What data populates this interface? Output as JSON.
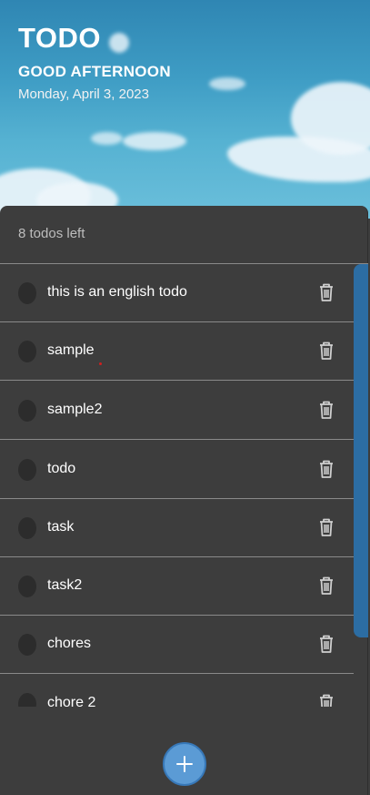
{
  "header": {
    "title": "TODO",
    "greeting": "GOOD AFTERNOON",
    "date": "Monday, April 3, 2023"
  },
  "status": {
    "todos_left": "8 todos left"
  },
  "todos": [
    {
      "label": "this is an english todo",
      "completed": false
    },
    {
      "label": "sample",
      "completed": false
    },
    {
      "label": "sample2",
      "completed": false
    },
    {
      "label": "todo",
      "completed": false
    },
    {
      "label": "task",
      "completed": false
    },
    {
      "label": "task2",
      "completed": false
    },
    {
      "label": "chores",
      "completed": false
    },
    {
      "label": "chore 2",
      "completed": false
    }
  ],
  "icons": {
    "delete": "trash-icon",
    "add": "plus-icon",
    "checkbox": "circle-checkbox"
  },
  "colors": {
    "panel": "#3d3d3d",
    "accent": "#5b9bd5",
    "scrollbar": "#2c6da3",
    "divider": "#8a8a8a"
  }
}
